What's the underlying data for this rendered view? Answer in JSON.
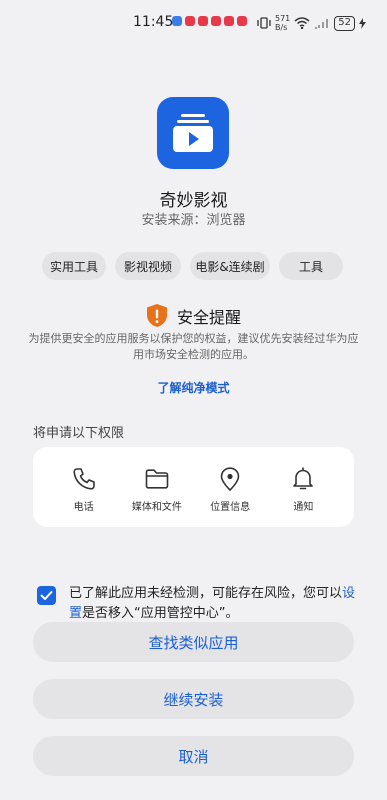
{
  "status_bar": {
    "time": "11:45",
    "net_speed": "571\nB/s",
    "battery": "52"
  },
  "app": {
    "name": "奇妙影视",
    "source": "安装来源：浏览器",
    "icon": "video-folder-icon",
    "icon_color": "#1c64e0"
  },
  "tags": [
    "实用工具",
    "影视视频",
    "电影&连续剧",
    "工具"
  ],
  "security": {
    "title": "安全提醒",
    "description": "为提供更安全的应用服务以保护您的权益，建议优先安装经过华为应用市场安全检测的应用。",
    "link": "了解纯净模式"
  },
  "permissions": {
    "heading": "将申请以下权限",
    "items": [
      {
        "label": "电话",
        "icon": "phone-icon"
      },
      {
        "label": "媒体和文件",
        "icon": "folder-icon"
      },
      {
        "label": "位置信息",
        "icon": "location-pin-icon"
      },
      {
        "label": "通知",
        "icon": "bell-icon"
      }
    ]
  },
  "consent": {
    "checked": true,
    "text_before": "已了解此应用未经检测，可能存在风险，您可以",
    "link": "设置",
    "text_after": "是否移入“应用管控中心”。"
  },
  "buttons": {
    "find_similar": "查找类似应用",
    "continue_install": "继续安装",
    "cancel": "取消"
  },
  "colors": {
    "accent": "#1c5fd1",
    "warning": "#e8711c"
  }
}
